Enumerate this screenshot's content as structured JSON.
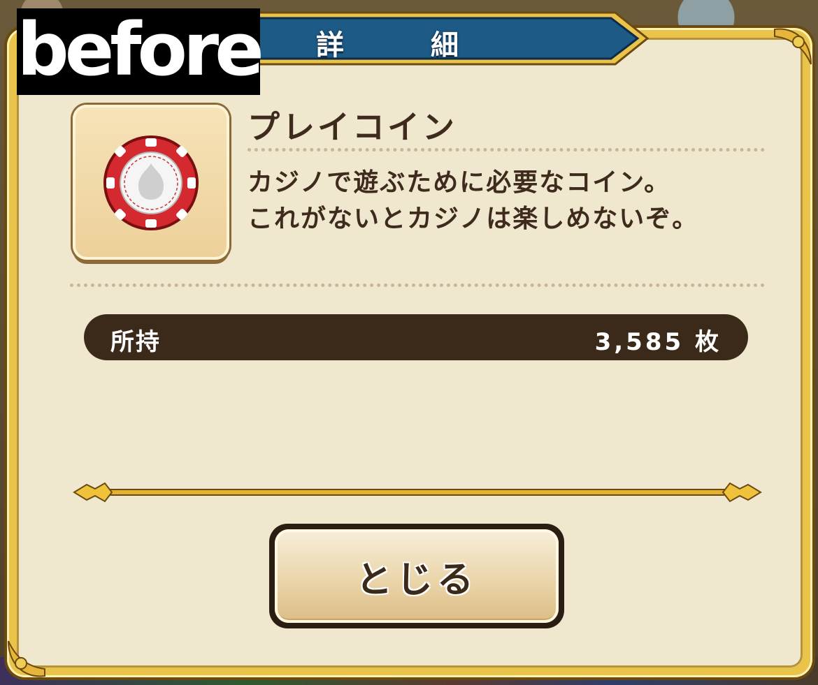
{
  "overlay": {
    "label": "before"
  },
  "dialog": {
    "title": "詳　細",
    "item": {
      "name": "プレイコイン",
      "icon": "casino-chip-icon",
      "description_lines": [
        "カジノで遊ぶために必要なコイン。",
        "これがないとカジノは楽しめないぞ。"
      ]
    },
    "owned": {
      "label": "所持",
      "value": "3,585 枚"
    },
    "close_button": {
      "label": "とじる"
    }
  },
  "colors": {
    "frame_gold": "#e9c34a",
    "panel_cream": "#f0e7cf",
    "title_blue": "#1d5a86",
    "owned_bar": "#3b2a1a",
    "text_brown": "#3e2b1e",
    "chip_red": "#d42a2f"
  }
}
